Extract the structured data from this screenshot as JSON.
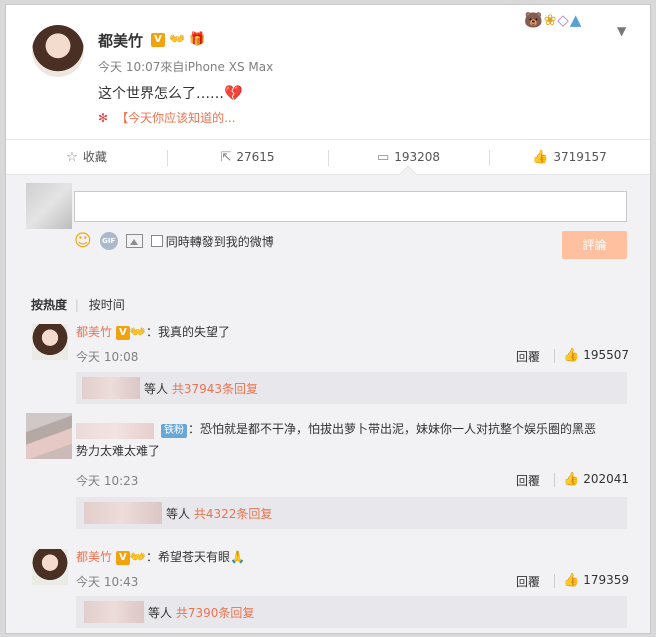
{
  "post": {
    "author": "都美竹",
    "v_badge": "V",
    "meta": "今天 10:07來自iPhone XS Max",
    "text": "这个世界怎么了……",
    "heart_emoji": "💔",
    "link_icon": "✻",
    "link_text": "【今天你应该知道的..."
  },
  "actions": {
    "favorite": "收藏",
    "repost": "27615",
    "comment": "193208",
    "like": "3719157"
  },
  "composer": {
    "gif_label": "GIF",
    "repost_checkbox": "同時轉發到我的微博",
    "submit": "評論"
  },
  "sort_tabs": {
    "hot": "按热度",
    "time": "按时间",
    "divider": "|"
  },
  "comments": [
    {
      "name": "都美竹",
      "v_badge": "V",
      "text": "：我真的失望了",
      "time": "今天 10:08",
      "reply": "回覆",
      "likes": "195507",
      "sub_prefix": "等人",
      "sub_count": "共37943条回复"
    },
    {
      "fan_badge": "铁粉",
      "text_line1": "：恐怕就是都不干净，怕拔出萝卜带出泥，妹妹你一人对抗整个娱乐圈的黑恶",
      "text_line2": "势力太难太难了",
      "time": "今天 10:23",
      "reply": "回覆",
      "likes": "202041",
      "sub_prefix": "等人",
      "sub_count": "共4322条回复"
    },
    {
      "name": "都美竹",
      "v_badge": "V",
      "text": "：希望苍天有眼",
      "pray_emoji": "🙏",
      "time": "今天 10:43",
      "reply": "回覆",
      "likes": "179359",
      "sub_prefix": "等人",
      "sub_count": "共7390条回复"
    }
  ],
  "colors": {
    "accent": "#eb7350",
    "submit_disabled": "#ffc09f",
    "v_badge": "#f2a20d",
    "comments_bg": "#f2f2f5"
  },
  "icons": [
    "star-icon",
    "repost-icon",
    "comment-icon",
    "thumbs-up-icon",
    "smile-icon",
    "gif-icon",
    "picture-icon",
    "chevron-down-icon",
    "gift-icon"
  ]
}
